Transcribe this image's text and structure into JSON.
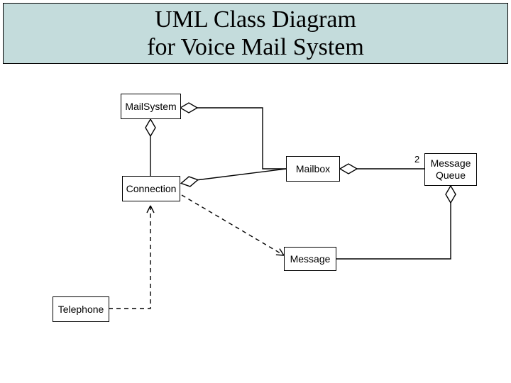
{
  "title": "UML Class Diagram\nfor Voice Mail System",
  "classes": {
    "mailsystem": "MailSystem",
    "connection": "Connection",
    "mailbox": "Mailbox",
    "message_queue": "Message\nQueue",
    "message": "Message",
    "telephone": "Telephone"
  },
  "multiplicities": {
    "mailbox_to_mqueue": "2"
  },
  "relationships": [
    {
      "from": "MailSystem",
      "to": "Connection",
      "type": "aggregation",
      "diamond_at": "MailSystem"
    },
    {
      "from": "MailSystem",
      "to": "Mailbox",
      "type": "aggregation",
      "diamond_at": "MailSystem"
    },
    {
      "from": "Connection",
      "to": "Mailbox",
      "type": "aggregation",
      "diamond_at": "Connection"
    },
    {
      "from": "Connection",
      "to": "Message",
      "type": "dependency",
      "arrow_at": "Message"
    },
    {
      "from": "Mailbox",
      "to": "MessageQueue",
      "type": "aggregation",
      "diamond_at": "Mailbox",
      "multiplicity": "2"
    },
    {
      "from": "MessageQueue",
      "to": "Message",
      "type": "aggregation",
      "diamond_at": "MessageQueue"
    },
    {
      "from": "Telephone",
      "to": "Connection",
      "type": "dependency",
      "arrow_at": "Connection"
    }
  ]
}
